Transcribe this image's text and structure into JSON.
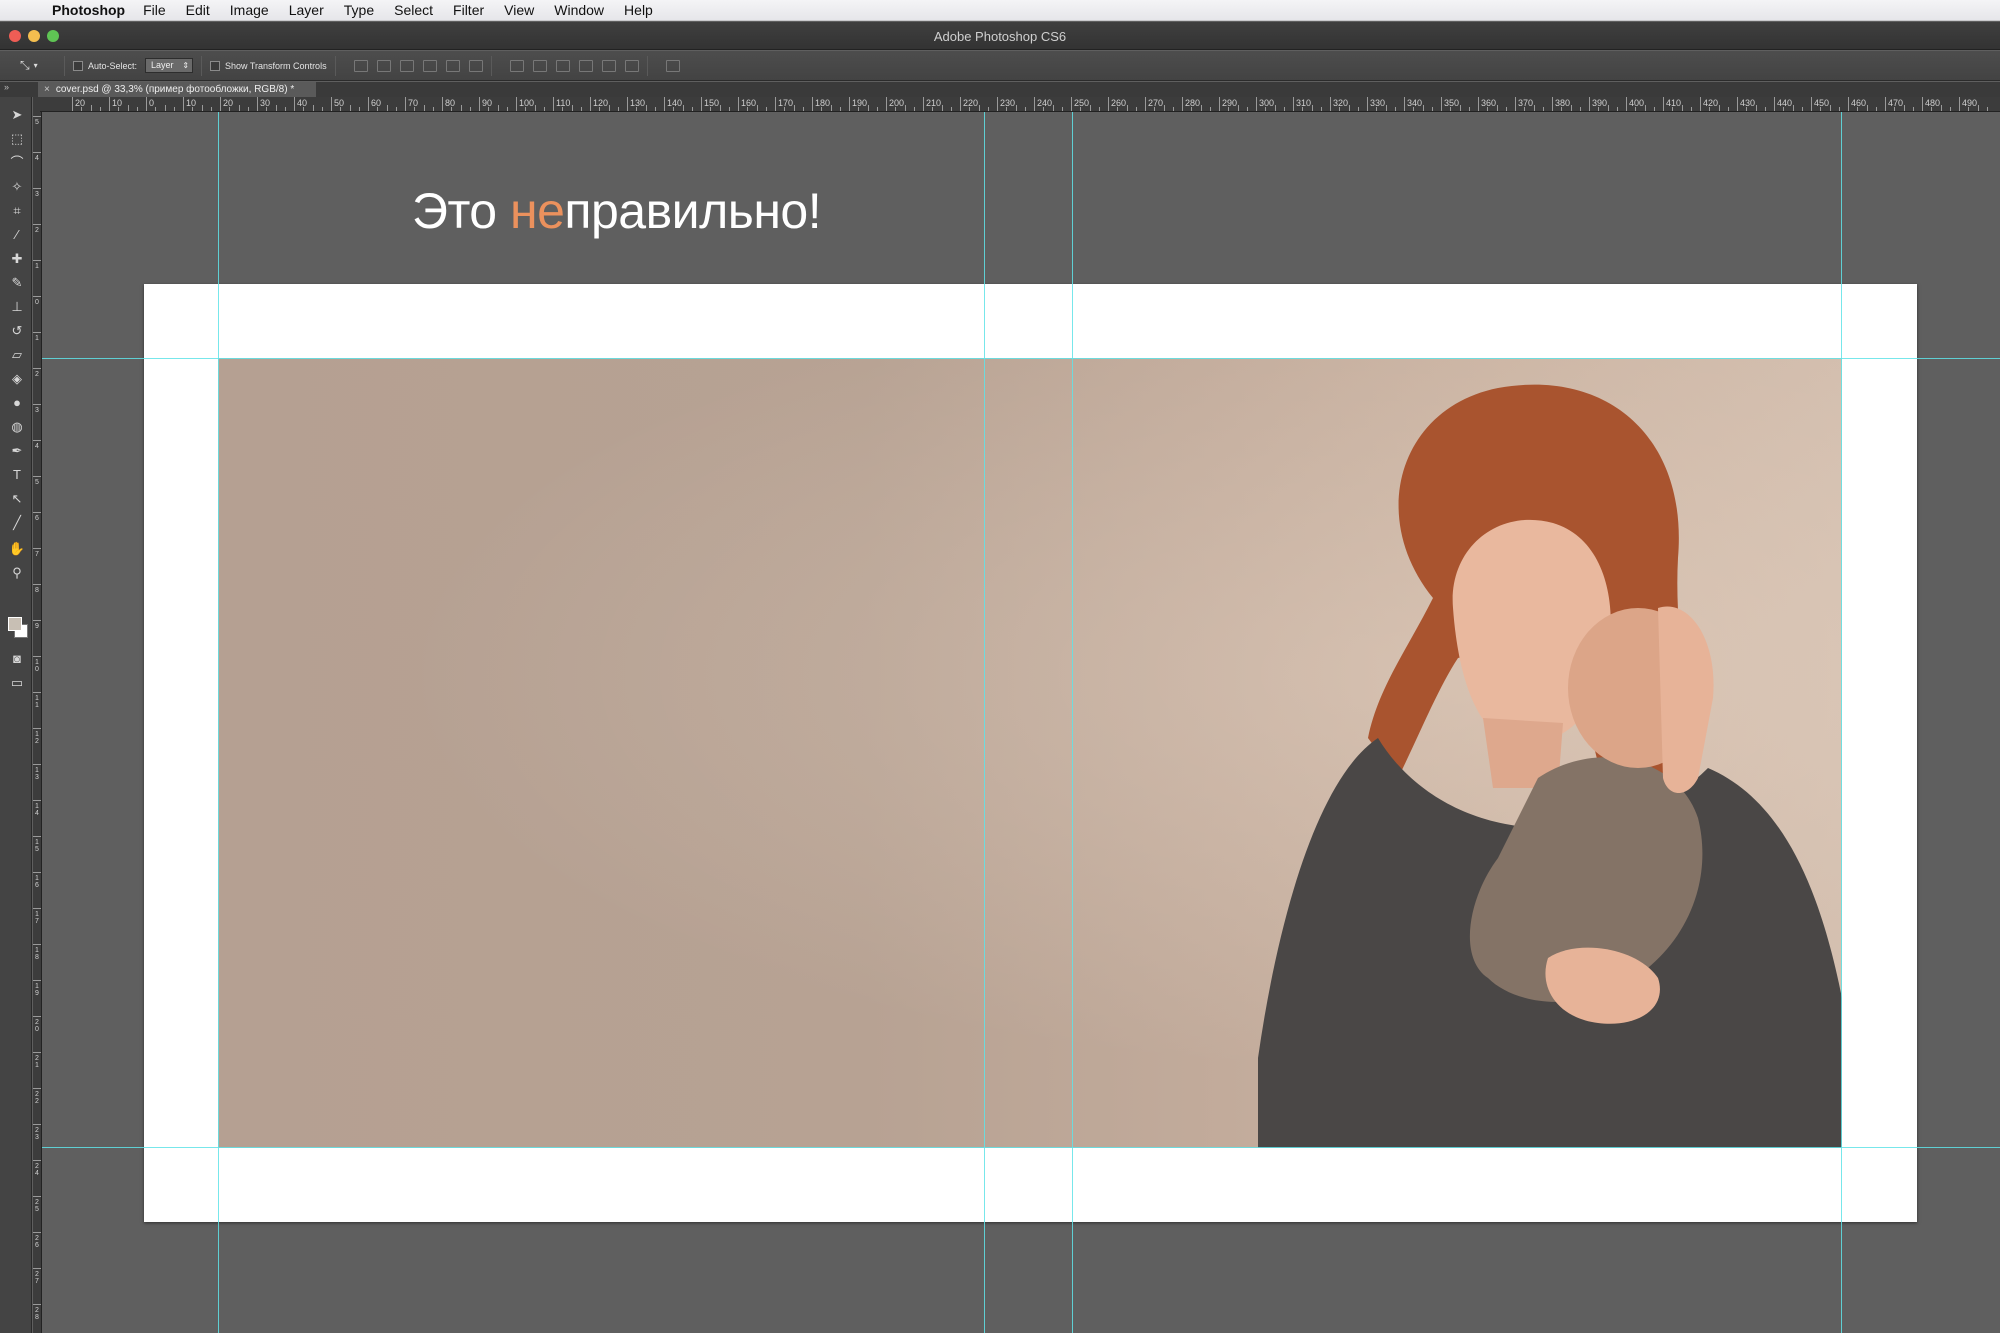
{
  "menubar": {
    "app_name": "Photoshop",
    "items": [
      "File",
      "Edit",
      "Image",
      "Layer",
      "Type",
      "Select",
      "Filter",
      "View",
      "Window",
      "Help"
    ]
  },
  "window": {
    "title": "Adobe Photoshop CS6"
  },
  "options": {
    "auto_select_label": "Auto-Select:",
    "auto_select_value": "Layer",
    "show_transform_label": "Show Transform Controls"
  },
  "document": {
    "tab_title": "cover.psd @ 33,3% (пример фотообложки, RGB/8) *"
  },
  "canvas": {
    "heading_part1": "Это ",
    "heading_accent": "не",
    "heading_part2": "правильно!",
    "accent_color": "#eb915d"
  },
  "ruler": {
    "h_labels": [
      "20",
      "10",
      "0",
      "10",
      "20",
      "30",
      "40",
      "50",
      "60",
      "70",
      "80",
      "90",
      "100",
      "110",
      "120",
      "130",
      "140",
      "150",
      "160",
      "170",
      "180",
      "190",
      "200",
      "210",
      "220",
      "230",
      "240",
      "250",
      "260",
      "270",
      "280",
      "290",
      "300",
      "310",
      "320",
      "330",
      "340",
      "350",
      "360",
      "370",
      "380",
      "390",
      "400",
      "410",
      "420",
      "430",
      "440",
      "450",
      "460",
      "470",
      "480",
      "490"
    ],
    "v_labels": [
      "5",
      "4",
      "3",
      "2",
      "1",
      "0",
      "1",
      "2",
      "3",
      "4",
      "5",
      "6",
      "7",
      "8",
      "9",
      "10",
      "11",
      "12",
      "13",
      "14",
      "15",
      "16",
      "17",
      "18",
      "19",
      "20",
      "21",
      "22",
      "23",
      "24",
      "25",
      "26",
      "27",
      "28"
    ]
  },
  "colors": {
    "guide": "#5fe3e8",
    "pasteboard": "#5f5f5f",
    "foreground_swatch": "#c8bfb4",
    "background_swatch": "#ffffff"
  }
}
